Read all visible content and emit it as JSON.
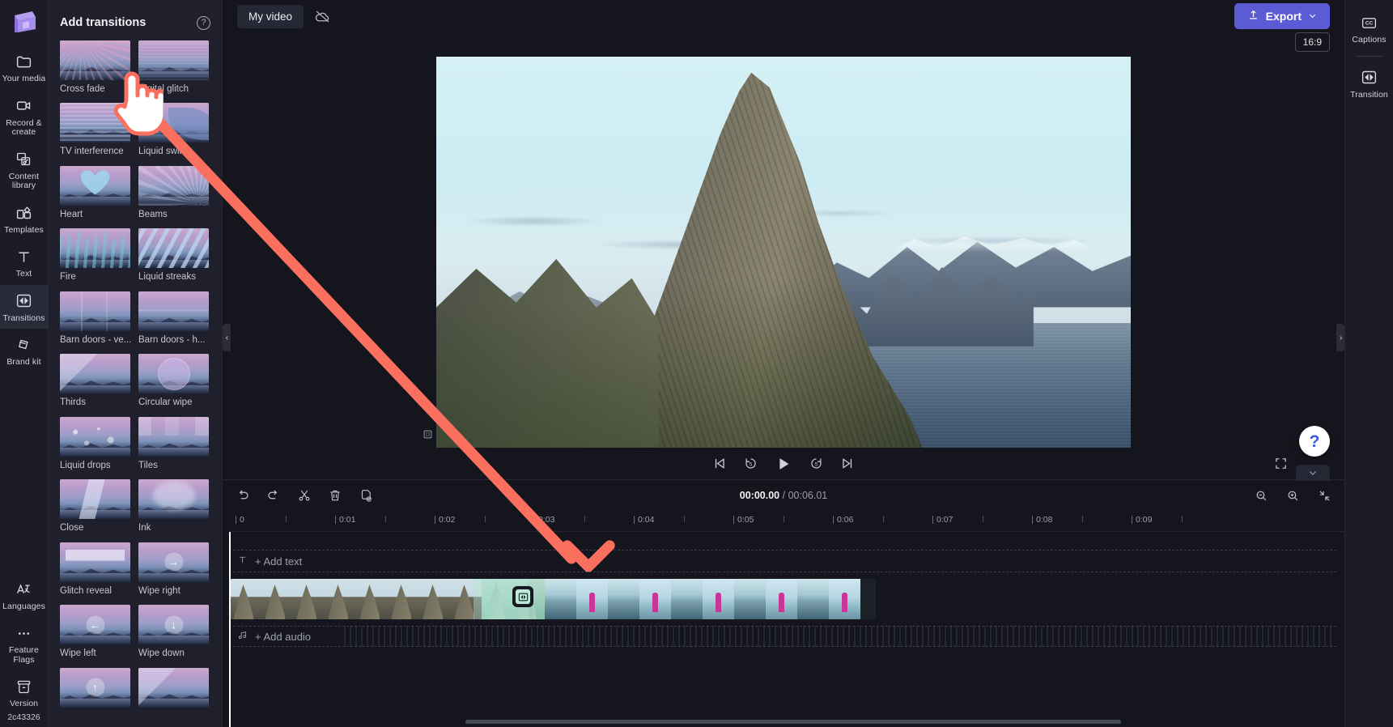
{
  "app": {
    "name": "Clipchamp video editor"
  },
  "left_rail": {
    "logo_icon": "clipchamp-logo-icon",
    "items": [
      {
        "id": "your-media",
        "label": "Your media",
        "icon": "folder-icon",
        "active": false
      },
      {
        "id": "record-create",
        "label": "Record & create",
        "icon": "camera-icon",
        "active": false
      },
      {
        "id": "content-library",
        "label": "Content library",
        "icon": "library-icon",
        "active": false
      },
      {
        "id": "templates",
        "label": "Templates",
        "icon": "templates-icon",
        "active": false
      },
      {
        "id": "text",
        "label": "Text",
        "icon": "text-icon",
        "active": false
      },
      {
        "id": "transitions",
        "label": "Transitions",
        "icon": "transitions-icon",
        "active": true
      },
      {
        "id": "brand-kit",
        "label": "Brand kit",
        "icon": "brand-kit-icon",
        "active": false
      }
    ],
    "bottom_items": [
      {
        "id": "languages",
        "label": "Languages",
        "icon": "translate-icon"
      },
      {
        "id": "feature-flags",
        "label": "Feature Flags",
        "icon": "ellipsis-icon"
      },
      {
        "id": "version",
        "label": "Version 2c43326",
        "label_line1": "Version",
        "label_line2": "2c43326",
        "icon": "archive-icon"
      }
    ]
  },
  "panel": {
    "title": "Add transitions",
    "help_icon": "question-mark-icon",
    "collapse_left_icon": "chevron-left-icon",
    "transitions": [
      {
        "name": "Cross fade",
        "variant": "v-cross"
      },
      {
        "name": "Digital glitch",
        "variant": "v-digital"
      },
      {
        "name": "TV interference",
        "variant": "v-tv"
      },
      {
        "name": "Liquid swirl",
        "variant": "v-swirl"
      },
      {
        "name": "Heart",
        "variant": "v-heart"
      },
      {
        "name": "Beams",
        "variant": "v-beams"
      },
      {
        "name": "Fire",
        "variant": "v-fire"
      },
      {
        "name": "Liquid streaks",
        "variant": "v-streaks"
      },
      {
        "name": "Barn doors - ve...",
        "variant": "v-barnv"
      },
      {
        "name": "Barn doors - h...",
        "variant": "v-barnh"
      },
      {
        "name": "Thirds",
        "variant": "v-thirds"
      },
      {
        "name": "Circular wipe",
        "variant": "v-circ"
      },
      {
        "name": "Liquid drops",
        "variant": "v-drops"
      },
      {
        "name": "Tiles",
        "variant": "v-tiles"
      },
      {
        "name": "Close",
        "variant": "v-close"
      },
      {
        "name": "Ink",
        "variant": "v-ink"
      },
      {
        "name": "Glitch reveal",
        "variant": "v-glitchr"
      },
      {
        "name": "Wipe right",
        "variant": "",
        "badge": "→"
      },
      {
        "name": "Wipe left",
        "variant": "",
        "badge": "←"
      },
      {
        "name": "Wipe down",
        "variant": "",
        "badge": "↓"
      },
      {
        "name": "",
        "variant": "",
        "badge": "↑"
      },
      {
        "name": "",
        "variant": "v-thirds"
      }
    ]
  },
  "topbar": {
    "project_name": "My video",
    "cloud_icon": "cloud-off-icon",
    "export_label": "Export",
    "export_icon": "upload-icon",
    "export_chevron_icon": "chevron-down-icon",
    "export_color": "#5b5bd6",
    "aspect_ratio": "16:9"
  },
  "player": {
    "crop_icon": "crop-icon",
    "controls": [
      {
        "id": "skip-back",
        "icon": "skip-previous-icon"
      },
      {
        "id": "back-5",
        "icon": "rewind-5-icon",
        "label": "5"
      },
      {
        "id": "play",
        "icon": "play-icon"
      },
      {
        "id": "forward-5",
        "icon": "forward-5-icon",
        "label": "5"
      },
      {
        "id": "skip-forward",
        "icon": "skip-next-icon"
      }
    ],
    "fullscreen_icon": "fullscreen-icon"
  },
  "timeline": {
    "tools": [
      {
        "id": "undo",
        "icon": "undo-icon"
      },
      {
        "id": "redo",
        "icon": "redo-icon"
      },
      {
        "id": "split",
        "icon": "scissors-icon"
      },
      {
        "id": "delete",
        "icon": "trash-icon"
      },
      {
        "id": "duplicate",
        "icon": "duplicate-icon"
      }
    ],
    "current_time": "00:00.00",
    "separator": "/",
    "total_time": "00:06.01",
    "zoom_tools": [
      {
        "id": "zoom-out",
        "icon": "zoom-out-icon"
      },
      {
        "id": "zoom-in",
        "icon": "zoom-in-icon"
      },
      {
        "id": "fit",
        "icon": "fit-to-screen-icon"
      }
    ],
    "ruler_labels": [
      "0",
      "0:01",
      "0:02",
      "0:03",
      "0:04",
      "0:05",
      "0:06",
      "0:07",
      "0:08",
      "0:09"
    ],
    "add_text_label": "+ Add text",
    "add_text_icon": "text-t-icon",
    "add_audio_label": "+ Add audio",
    "add_audio_icon": "music-note-icon",
    "transition_marker_icon": "transition-icon",
    "playhead_position": "0"
  },
  "right_rail": {
    "collapse_right_icon": "chevron-right-icon",
    "items": [
      {
        "id": "captions",
        "label": "Captions",
        "icon": "cc-icon"
      },
      {
        "id": "transition",
        "label": "Transition",
        "icon": "transition-icon"
      }
    ],
    "help_fab_icon": "question-mark-icon",
    "tray_chevron_icon": "chevron-down-icon"
  },
  "annotation": {
    "cursor_icon": "pointing-hand-cursor",
    "arrow_icon": "red-arrow-annotation",
    "arrow_color": "#fa6f5e"
  }
}
